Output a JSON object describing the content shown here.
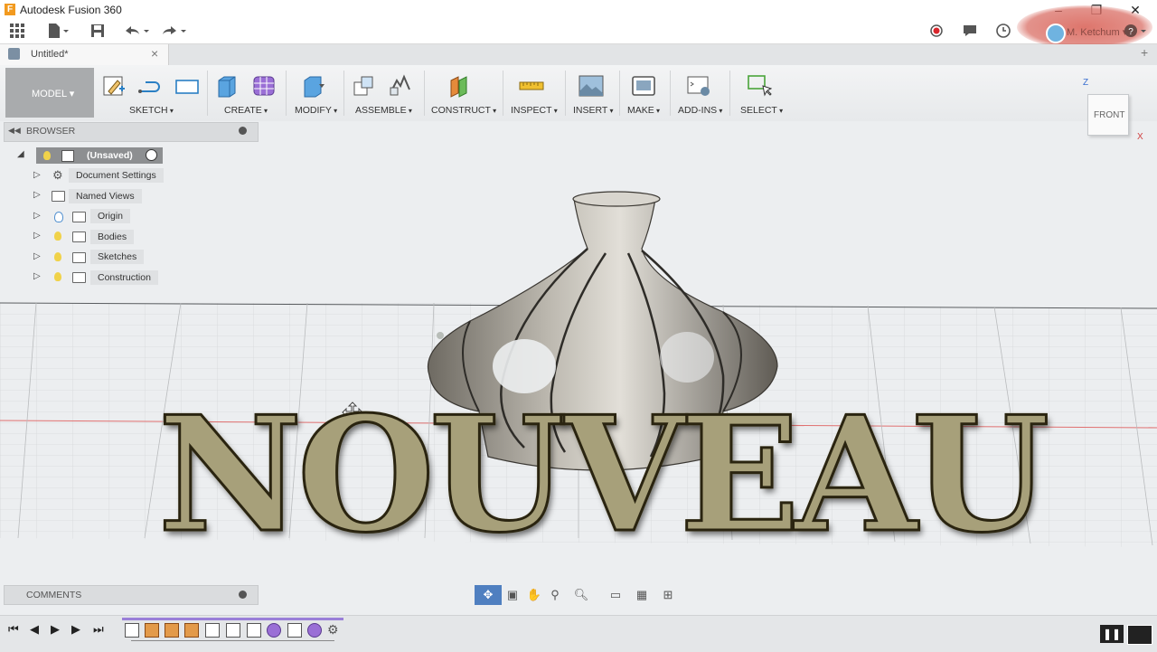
{
  "window": {
    "title": "Autodesk Fusion 360",
    "controls": [
      "minimize-icon",
      "restore-icon",
      "close-icon"
    ]
  },
  "quick_access": {
    "icons": [
      "grid-menu-icon",
      "file-icon",
      "save-icon",
      "undo-icon",
      "redo-icon"
    ],
    "right_icons": [
      "record-icon",
      "comment-icon",
      "clock-icon"
    ],
    "user_name": "M. Ketchum",
    "help_icon": "help-icon"
  },
  "document_tab": {
    "label": "Untitled*"
  },
  "toolbar": {
    "workspace": "MODEL",
    "groups": [
      {
        "label": "SKETCH"
      },
      {
        "label": "CREATE"
      },
      {
        "label": "MODIFY"
      },
      {
        "label": "ASSEMBLE"
      },
      {
        "label": "CONSTRUCT"
      },
      {
        "label": "INSPECT"
      },
      {
        "label": "INSERT"
      },
      {
        "label": "MAKE"
      },
      {
        "label": "ADD-INS"
      },
      {
        "label": "SELECT"
      }
    ]
  },
  "browser": {
    "title": "BROWSER",
    "root": "(Unsaved)",
    "items": [
      {
        "label": "Document Settings"
      },
      {
        "label": "Named Views"
      },
      {
        "label": "Origin"
      },
      {
        "label": "Bodies"
      },
      {
        "label": "Sketches"
      },
      {
        "label": "Construction"
      }
    ]
  },
  "viewcube": {
    "face": "FRONT",
    "axis_z": "Z",
    "axis_x": "X"
  },
  "overlay_text": "NOUVEAU",
  "comments": {
    "title": "COMMENTS"
  },
  "colors": {
    "accent": "#f29a1f",
    "workspace_bg": "#a9abad",
    "overlay_fill": "#a7a07a",
    "overlay_outline": "#e3d55a"
  }
}
